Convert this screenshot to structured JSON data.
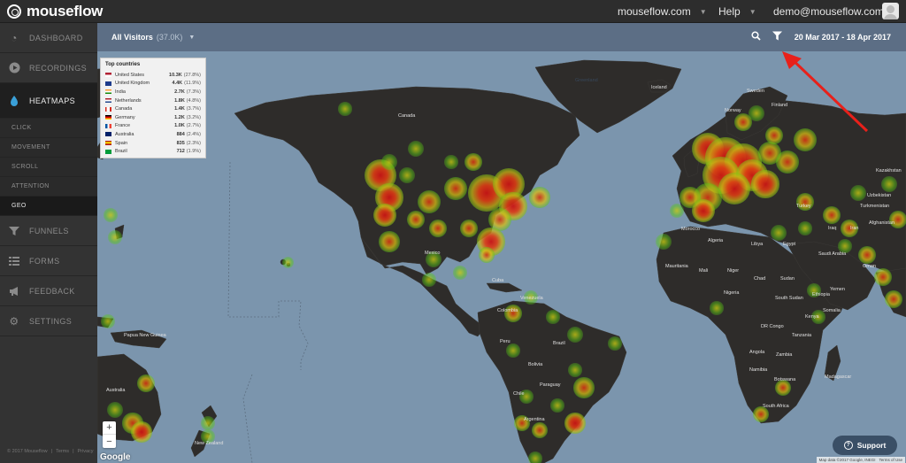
{
  "app": {
    "brand": "mouseflow"
  },
  "topnav": {
    "site": "mouseflow.com",
    "help": "Help",
    "user": "demo@mouseflow.com"
  },
  "sidebar": {
    "items": [
      {
        "label": "DASHBOARD",
        "icon": "gauge-icon"
      },
      {
        "label": "RECORDINGS",
        "icon": "play-icon"
      },
      {
        "label": "HEATMAPS",
        "icon": "heatmap-icon"
      }
    ],
    "subitems": [
      "CLICK",
      "MOVEMENT",
      "SCROLL",
      "ATTENTION",
      "GEO"
    ],
    "items_after": [
      {
        "label": "FUNNELS",
        "icon": "funnel-icon"
      },
      {
        "label": "FORMS",
        "icon": "form-icon"
      },
      {
        "label": "FEEDBACK",
        "icon": "megaphone-icon"
      },
      {
        "label": "SETTINGS",
        "icon": "gear-icon"
      }
    ],
    "footer": {
      "copyright": "© 2017 Mouseflow",
      "terms": "Terms",
      "privacy": "Privacy"
    }
  },
  "header": {
    "visitors_label": "All Visitors",
    "visitors_count": "(37.0K)",
    "date_range": "20 Mar 2017 - 18 Apr 2017"
  },
  "top_countries": {
    "title": "Top countries",
    "rows": [
      {
        "name": "United States",
        "value": "10.3K",
        "pct": "(27.8%)",
        "flag": "us"
      },
      {
        "name": "United Kingdom",
        "value": "4.4K",
        "pct": "(11.9%)",
        "flag": "gb"
      },
      {
        "name": "India",
        "value": "2.7K",
        "pct": "(7.3%)",
        "flag": "in"
      },
      {
        "name": "Netherlands",
        "value": "1.8K",
        "pct": "(4.8%)",
        "flag": "nl"
      },
      {
        "name": "Canada",
        "value": "1.4K",
        "pct": "(3.7%)",
        "flag": "ca"
      },
      {
        "name": "Germany",
        "value": "1.2K",
        "pct": "(3.2%)",
        "flag": "de"
      },
      {
        "name": "France",
        "value": "1.0K",
        "pct": "(2.7%)",
        "flag": "fr"
      },
      {
        "name": "Australia",
        "value": "884",
        "pct": "(2.4%)",
        "flag": "au"
      },
      {
        "name": "Spain",
        "value": "835",
        "pct": "(2.3%)",
        "flag": "es"
      },
      {
        "name": "Brazil",
        "value": "712",
        "pct": "(1.9%)",
        "flag": "br"
      }
    ]
  },
  "map": {
    "labels": {
      "greenland": "Greenland",
      "iceland": "Iceland",
      "sweden": "Sweden",
      "finland": "Finland",
      "norway": "Norway",
      "canada": "Canada",
      "alaska": "Alaska",
      "kazakhstan": "Kazakhstan",
      "uzbekistan": "Uzbekistan",
      "turkmenistan": "Turkmenistan",
      "afghanistan": "Afghanistan",
      "iran": "Iran",
      "iraq": "Iraq",
      "turkey": "Turkey",
      "mexico": "Mexico",
      "cuba": "Cuba",
      "venezuela": "Venezuela",
      "colombia": "Colombia",
      "peru": "Peru",
      "brazil": "Brazil",
      "bolivia": "Bolivia",
      "paraguay": "Paraguay",
      "chile": "Chile",
      "argentina": "Argentina",
      "morocco": "Morocco",
      "algeria": "Algeria",
      "libya": "Libya",
      "egypt": "Egypt",
      "mauritania": "Mauritania",
      "mali": "Mali",
      "niger": "Niger",
      "chad": "Chad",
      "sudan": "Sudan",
      "nigeria": "Nigeria",
      "ethiopia": "Ethiopia",
      "south_sudan": "South Sudan",
      "somalia": "Somalia",
      "kenya": "Kenya",
      "tanzania": "Tanzania",
      "drc": "DR Congo",
      "angola": "Angola",
      "zambia": "Zambia",
      "namibia": "Namibia",
      "botswana": "Botswana",
      "south_africa": "South Africa",
      "madagascar": "Madagascar",
      "saudi": "Saudi Arabia",
      "oman": "Oman",
      "yemen": "Yemen",
      "png": "Papua New Guinea",
      "australia_label": "Australia",
      "nz": "New Zealand"
    },
    "attribution": "Map data ©2017 Google, INEGI",
    "terms": "Terms of Use",
    "google": "Google",
    "zoom_in": "+",
    "zoom_out": "−"
  },
  "support": {
    "label": "Support"
  },
  "colors": {
    "header": "#5c6e85",
    "ocean": "#7b95ad",
    "land": "#2e2c2a",
    "accent": "#3aa0d8",
    "arrow": "#e8201a"
  }
}
